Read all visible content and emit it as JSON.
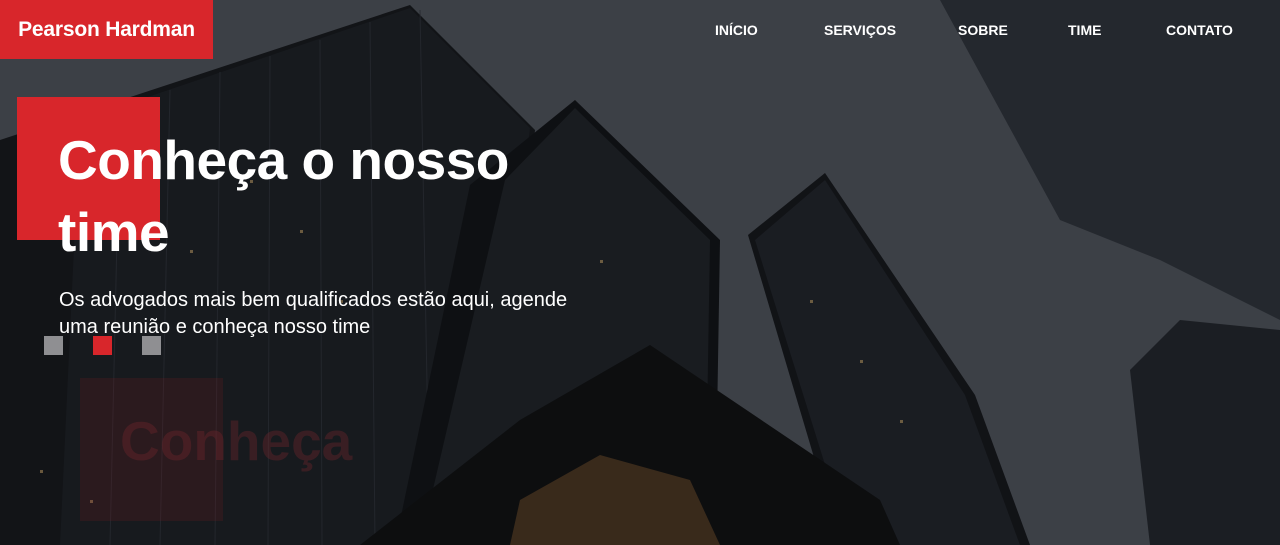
{
  "brand": {
    "name": "Pearson Hardman",
    "accent_color": "#d8262b"
  },
  "nav": {
    "items": [
      {
        "label": "INÍCIO"
      },
      {
        "label": "SERVIÇOS"
      },
      {
        "label": "SOBRE"
      },
      {
        "label": "TIME"
      },
      {
        "label": "CONTATO"
      }
    ]
  },
  "hero": {
    "headline": "Conheça o nosso time",
    "subtext": "Os advogados mais bem qualificados estão aqui, agende uma reunião e conheça nosso time",
    "ghost_text": "Conheça",
    "slides": {
      "count": 3,
      "active_index": 1
    }
  }
}
